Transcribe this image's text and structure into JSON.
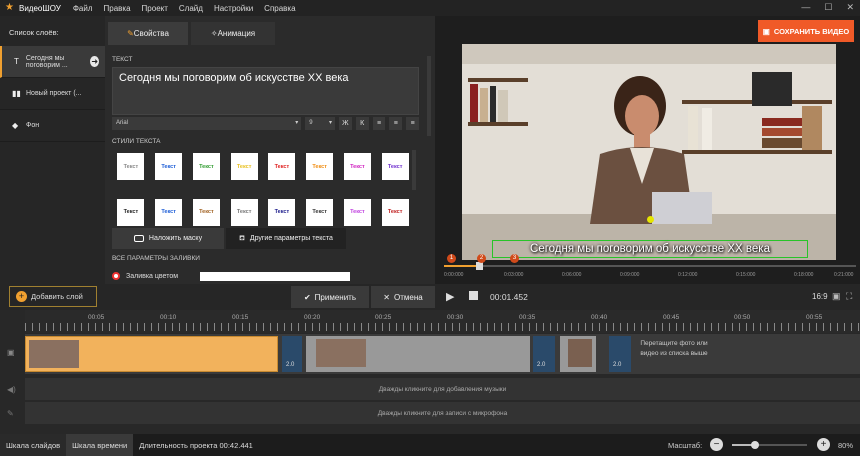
{
  "app": {
    "name": "ВидеоШОУ",
    "menu": [
      "Файл",
      "Правка",
      "Проект",
      "Слайд",
      "Настройки",
      "Справка"
    ]
  },
  "layers": {
    "header": "Список слоёв:",
    "items": [
      {
        "label": "Сегодня мы поговорим ...",
        "icon": "T"
      },
      {
        "label": "Новый проект (...",
        "icon": "▮▮"
      },
      {
        "label": "Фон",
        "icon": "◆"
      }
    ]
  },
  "tabs": {
    "properties": "Свойства",
    "animation": "Анимация"
  },
  "properties": {
    "text_label": "ТЕКСТ",
    "text_value": "Сегодня мы поговорим об искусстве XX века",
    "font": "Arial",
    "font_size": "9",
    "styles_label": "СТИЛИ ТЕКСТА",
    "style_tile_text": [
      "Текст",
      "Текст",
      "Текст",
      "Текст",
      "Текст",
      "Текст",
      "Текст",
      "Текст",
      "Текст",
      "Текст",
      "Текст",
      "Текст",
      "Текст",
      "Текст",
      "Текст",
      "Текст"
    ],
    "mask_button": "Наложить маску",
    "other_params_button": "Другие параметры текста",
    "fill_params_label": "ВСЕ ПАРАМЕТРЫ ЗАЛИВКИ",
    "fill_color_label": "Заливка цветом"
  },
  "preview": {
    "save_button": "СОХРАНИТЬ ВИДЕО",
    "caption": "Сегодня мы поговорим об искусстве XX века",
    "ruler_ticks": [
      "0:00:000",
      "0:03:000",
      "0:06:000",
      "0:09:000",
      "0:12:000",
      "0:15:000",
      "0:18:000",
      "0:21:000"
    ],
    "markers": [
      "1",
      "2",
      "3"
    ],
    "time": "00:01.452",
    "aspect": "16:9"
  },
  "editbar": {
    "add_layer": "Добавить слой",
    "apply": "Применить",
    "cancel": "Отмена"
  },
  "timeline": {
    "ticks": [
      "00:05",
      "00:10",
      "00:15",
      "00:20",
      "00:25",
      "00:30",
      "00:35",
      "00:40",
      "00:45",
      "00:50",
      "00:55"
    ],
    "transition_durations": [
      "2.0",
      "2.0",
      "2.0",
      "2.0"
    ],
    "drop_hint": "Перетащите фото или видео из списка выше",
    "music_hint": "Дважды кликните для добавления музыки",
    "mic_hint": "Дважды кликните для записи с микрофона"
  },
  "status": {
    "slides_tab": "Шкала слайдов",
    "timeline_tab": "Шкала времени",
    "duration": "Длительность проекта 00:42.441",
    "scale_label": "Масштаб:",
    "zoom": "80%",
    "zoom_level": 0.3
  },
  "colors": {
    "accent": "#f0a030",
    "save": "#f05a28"
  }
}
